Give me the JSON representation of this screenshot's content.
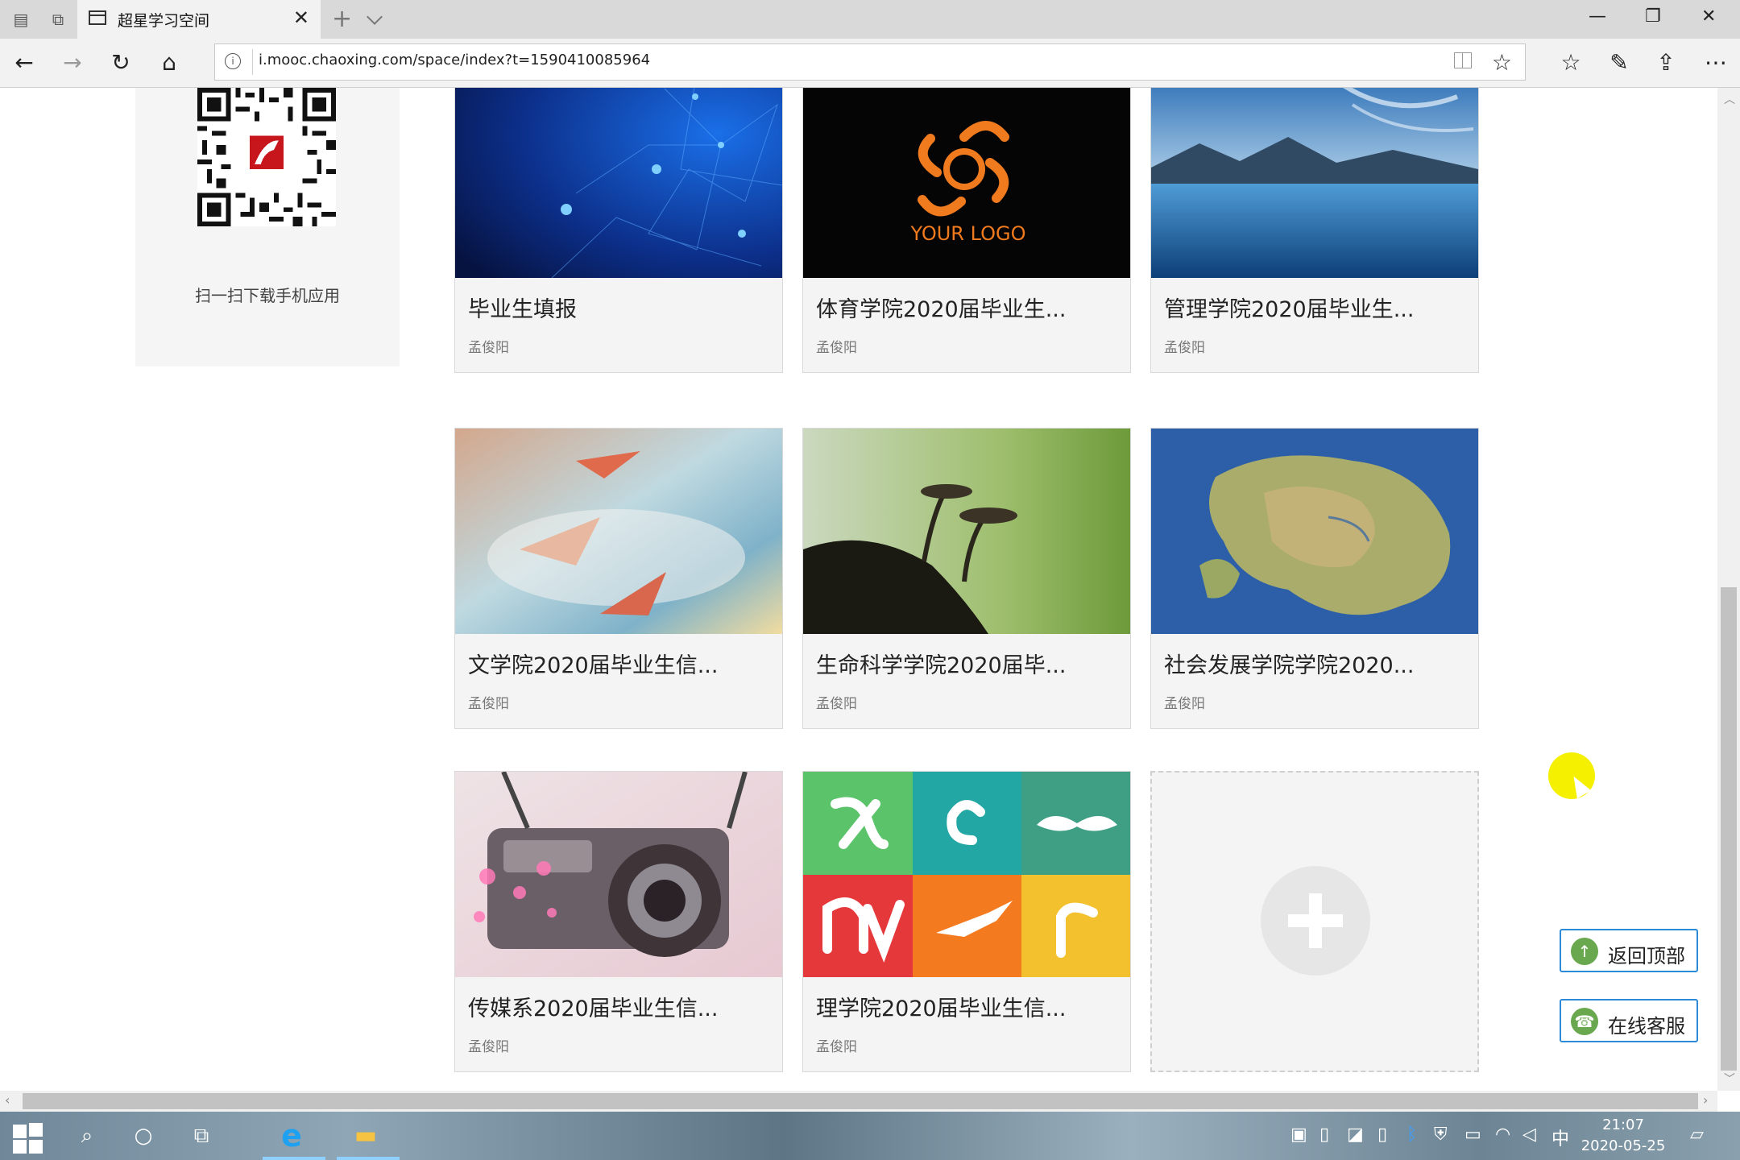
{
  "browser": {
    "tab_title": "超星学习空间",
    "tab_close": "✕",
    "new_tab": "+",
    "url": "i.mooc.chaoxing.com/space/index?t=1590410085964",
    "info_glyph": "i",
    "window_controls": {
      "minimize": "—",
      "restore": "❐",
      "close": "✕"
    },
    "nav_icons": {
      "back": "←",
      "forward": "→",
      "refresh": "↻",
      "home": "⌂",
      "favorites": "☆",
      "pen": "✎",
      "share": "⇪",
      "more": "⋯",
      "favorite_star": "☆"
    }
  },
  "sidebar": {
    "qr_caption": "扫一扫下载手机应用"
  },
  "cards": [
    {
      "title": "毕业生填报",
      "author": "孟俊阳",
      "thumb": "network-blue"
    },
    {
      "title": "体育学院2020届毕业生...",
      "author": "孟俊阳",
      "thumb": "your-logo",
      "thumb_text": "YOUR LOGO"
    },
    {
      "title": "管理学院2020届毕业生...",
      "author": "孟俊阳",
      "thumb": "lake-mountains"
    },
    {
      "title": "文学院2020届毕业生信...",
      "author": "孟俊阳",
      "thumb": "paper-planes"
    },
    {
      "title": "生命科学学院2020届毕...",
      "author": "孟俊阳",
      "thumb": "mushrooms"
    },
    {
      "title": "社会发展学院学院2020...",
      "author": "孟俊阳",
      "thumb": "fantasy-map"
    },
    {
      "title": "传媒系2020届毕业生信...",
      "author": "孟俊阳",
      "thumb": "camera"
    },
    {
      "title": "理学院2020届毕业生信...",
      "author": "孟俊阳",
      "thumb": "app-logos-grid"
    }
  ],
  "float_buttons": {
    "back_to_top": "返回顶部",
    "online_service": "在线客服"
  },
  "taskbar": {
    "time": "21:07",
    "date": "2020-05-25",
    "ime": "中"
  },
  "colors": {
    "accent": "#2c8ad8",
    "cursor_halo": "#f5f000"
  }
}
